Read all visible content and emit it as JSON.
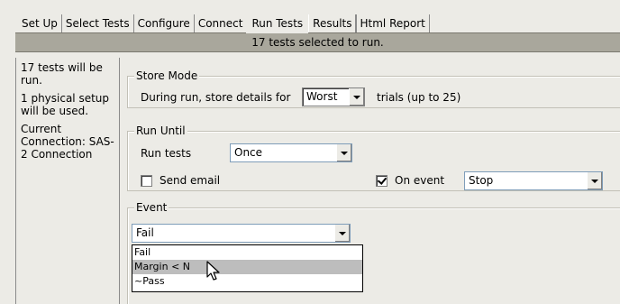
{
  "tabs": [
    {
      "label": "Set Up"
    },
    {
      "label": "Select Tests"
    },
    {
      "label": "Configure"
    },
    {
      "label": "Connect"
    },
    {
      "label": "Run Tests",
      "active": true
    },
    {
      "label": "Results"
    },
    {
      "label": "Html Report"
    }
  ],
  "status": "17 tests selected to run.",
  "info": {
    "line1": "17 tests will be run.",
    "line2": "1 physical setup will be used.",
    "line3": "Current Connection: SAS-2 Connection"
  },
  "store_mode": {
    "legend": "Store Mode",
    "label": "During run, store details for",
    "value": "Worst",
    "suffix": "trials (up to 25)"
  },
  "run_until": {
    "legend": "Run Until",
    "run_label": "Run tests",
    "run_value": "Once",
    "email_label": "Send email",
    "email_checked": false,
    "event_label": "On event",
    "event_checked": true,
    "event_value": "Stop"
  },
  "event": {
    "legend": "Event",
    "value": "Fail",
    "options": [
      {
        "label": "Fail"
      },
      {
        "label": "Margin < N",
        "highlighted": true
      },
      {
        "label": "~Pass"
      }
    ]
  }
}
